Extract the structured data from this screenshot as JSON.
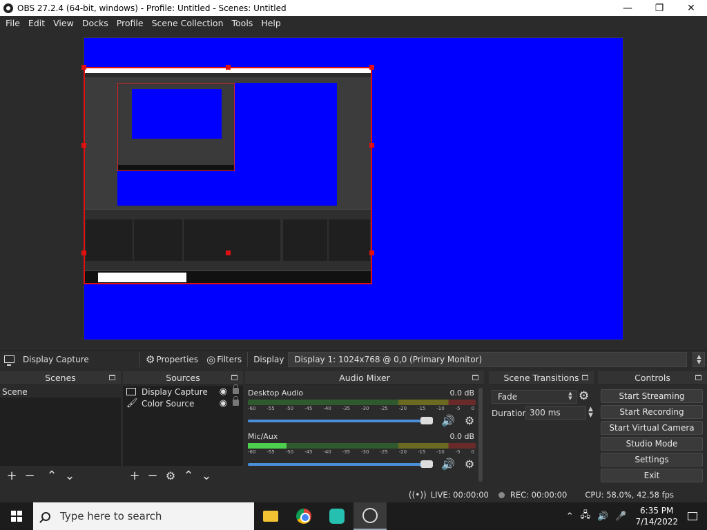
{
  "window": {
    "title": "OBS 27.2.4 (64-bit, windows) - Profile: Untitled - Scenes: Untitled",
    "minimize": "—",
    "maximize": "❐",
    "close": "✕"
  },
  "menu": [
    "File",
    "Edit",
    "View",
    "Docks",
    "Profile",
    "Scene Collection",
    "Tools",
    "Help"
  ],
  "source_toolbar": {
    "source_name": "Display Capture",
    "properties": "Properties",
    "filters": "Filters",
    "display_label": "Display",
    "display_value": "Display 1: 1024x768 @ 0,0 (Primary Monitor)"
  },
  "scenes": {
    "header": "Scenes",
    "items": [
      "Scene"
    ]
  },
  "sources": {
    "header": "Sources",
    "items": [
      "Display Capture",
      "Color Source"
    ]
  },
  "mixer": {
    "header": "Audio Mixer",
    "ticks": [
      "-60",
      "-55",
      "-50",
      "-45",
      "-40",
      "-35",
      "-30",
      "-25",
      "-20",
      "-15",
      "-10",
      "-5",
      "0"
    ],
    "channels": [
      {
        "name": "Desktop Audio",
        "db": "0.0 dB",
        "level": 0.0
      },
      {
        "name": "Mic/Aux",
        "db": "0.0 dB",
        "level": 0.17
      }
    ]
  },
  "transitions": {
    "header": "Scene Transitions",
    "selected": "Fade",
    "duration_label": "Duration",
    "duration_value": "300 ms"
  },
  "controls": {
    "header": "Controls",
    "buttons": [
      "Start Streaming",
      "Start Recording",
      "Start Virtual Camera",
      "Studio Mode",
      "Settings",
      "Exit"
    ]
  },
  "status": {
    "live": "LIVE: 00:00:00",
    "rec": "REC: 00:00:00",
    "cpu": "CPU: 58.0%, 42.58 fps"
  },
  "taskbar": {
    "search_placeholder": "Type here to search",
    "time": "6:35 PM",
    "date": "7/14/2022"
  },
  "colors": {
    "canvas_blue": "#0000ff",
    "selection_red": "#e01010",
    "panel_bg": "#2b2b2b"
  }
}
